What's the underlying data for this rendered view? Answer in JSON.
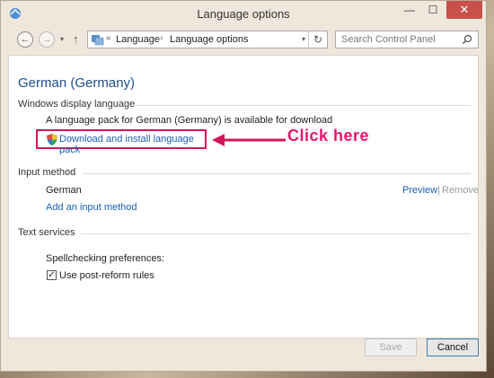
{
  "window": {
    "title": "Language options",
    "min_glyph": "—",
    "max_glyph": "☐",
    "close_glyph": "✕"
  },
  "nav": {
    "back_glyph": "←",
    "forward_glyph": "→",
    "dropdown_glyph": "▾",
    "up_glyph": "↑"
  },
  "address": {
    "overflow": "«",
    "crumbs": [
      "Language",
      "Language options"
    ],
    "separator": "›",
    "dropdown_glyph": "▾",
    "refresh_glyph": "↻"
  },
  "search": {
    "placeholder": "Search Control Panel"
  },
  "page": {
    "language_title": "German (Germany)",
    "display_section": {
      "heading": "Windows display language",
      "message": "A language pack for German (Germany) is available for download",
      "download_link": "Download and install language pack"
    },
    "annotation": {
      "text": "Click here",
      "color": "#e7166d"
    },
    "input_section": {
      "heading": "Input method",
      "method": "German",
      "preview": "Preview",
      "divider": "|",
      "remove": "Remove",
      "add_link": "Add an input method"
    },
    "text_section": {
      "heading": "Text services",
      "spell_label": "Spellchecking preferences:",
      "checkbox_label": "Use post-reform rules",
      "checkbox_checked": true,
      "check_glyph": "✓"
    }
  },
  "buttons": {
    "save": "Save",
    "cancel": "Cancel"
  },
  "colors": {
    "link": "#1a5fb4",
    "title": "#1e4e8c",
    "close": "#c7504b"
  }
}
